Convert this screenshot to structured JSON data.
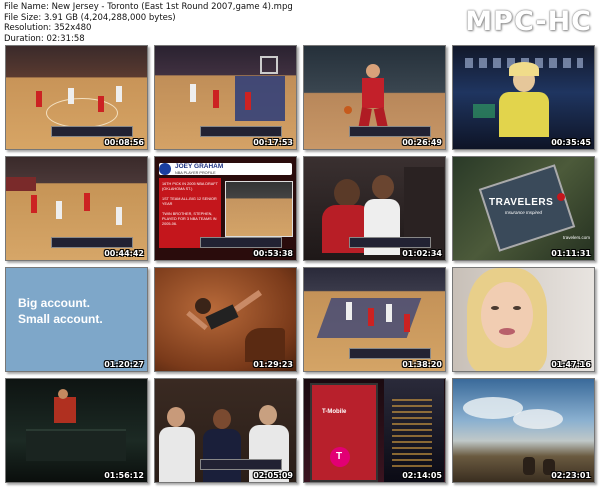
{
  "file_info": {
    "file_name": "File Name: New Jersey - Toronto (East 1st Round 2007,game 4).mpg",
    "file_size": "File Size: 3.91 GB (4,204,288,000 bytes)",
    "resolution": "Resolution: 352x480",
    "duration": "Duration: 02:31:58"
  },
  "logo": "MPC-HC",
  "thumbnails": [
    {
      "timestamp": "00:08:56",
      "scene": "basketball-court"
    },
    {
      "timestamp": "00:17:53",
      "scene": "basketball-court"
    },
    {
      "timestamp": "00:26:49",
      "scene": "basketball-player-dribble"
    },
    {
      "timestamp": "00:35:45",
      "scene": "studio-presenter"
    },
    {
      "timestamp": "00:44:42",
      "scene": "basketball-court"
    },
    {
      "timestamp": "00:53:38",
      "scene": "player-profile-graphic"
    },
    {
      "timestamp": "01:02:34",
      "scene": "players-closeup"
    },
    {
      "timestamp": "01:11:31",
      "scene": "travelers-ad"
    },
    {
      "timestamp": "01:20:27",
      "scene": "text-ad"
    },
    {
      "timestamp": "01:29:23",
      "scene": "rock-climber"
    },
    {
      "timestamp": "01:38:20",
      "scene": "basketball-court"
    },
    {
      "timestamp": "01:47:16",
      "scene": "woman-closeup"
    },
    {
      "timestamp": "01:56:12",
      "scene": "dark-room"
    },
    {
      "timestamp": "02:05:09",
      "scene": "bench-players"
    },
    {
      "timestamp": "02:14:05",
      "scene": "tmobile-ad"
    },
    {
      "timestamp": "02:23:01",
      "scene": "sky-landscape"
    }
  ],
  "profile_card": {
    "name": "JOEY GRAHAM",
    "subtitle": "NBA PLAYER PROFILE",
    "fact1": "16TH PICK IN 2005 NBA DRAFT (OKLAHOMA ST.)",
    "fact2": "1ST TEAM ALL-BIG 12 SENIOR YEAR",
    "fact3": "TWIN BROTHER, STEPHEN, PLAYED FOR 3 NBA TEAMS IN 2005-06."
  },
  "travelers_ad": {
    "brand": "TRAVELERS",
    "tagline": "Insurance Inspired",
    "url": "travelers.com"
  },
  "text_ad": {
    "line1": "Big account.",
    "line2": "Small account."
  },
  "tmobile_ad": {
    "brand": "T-Mobile",
    "logo_letter": "T"
  }
}
